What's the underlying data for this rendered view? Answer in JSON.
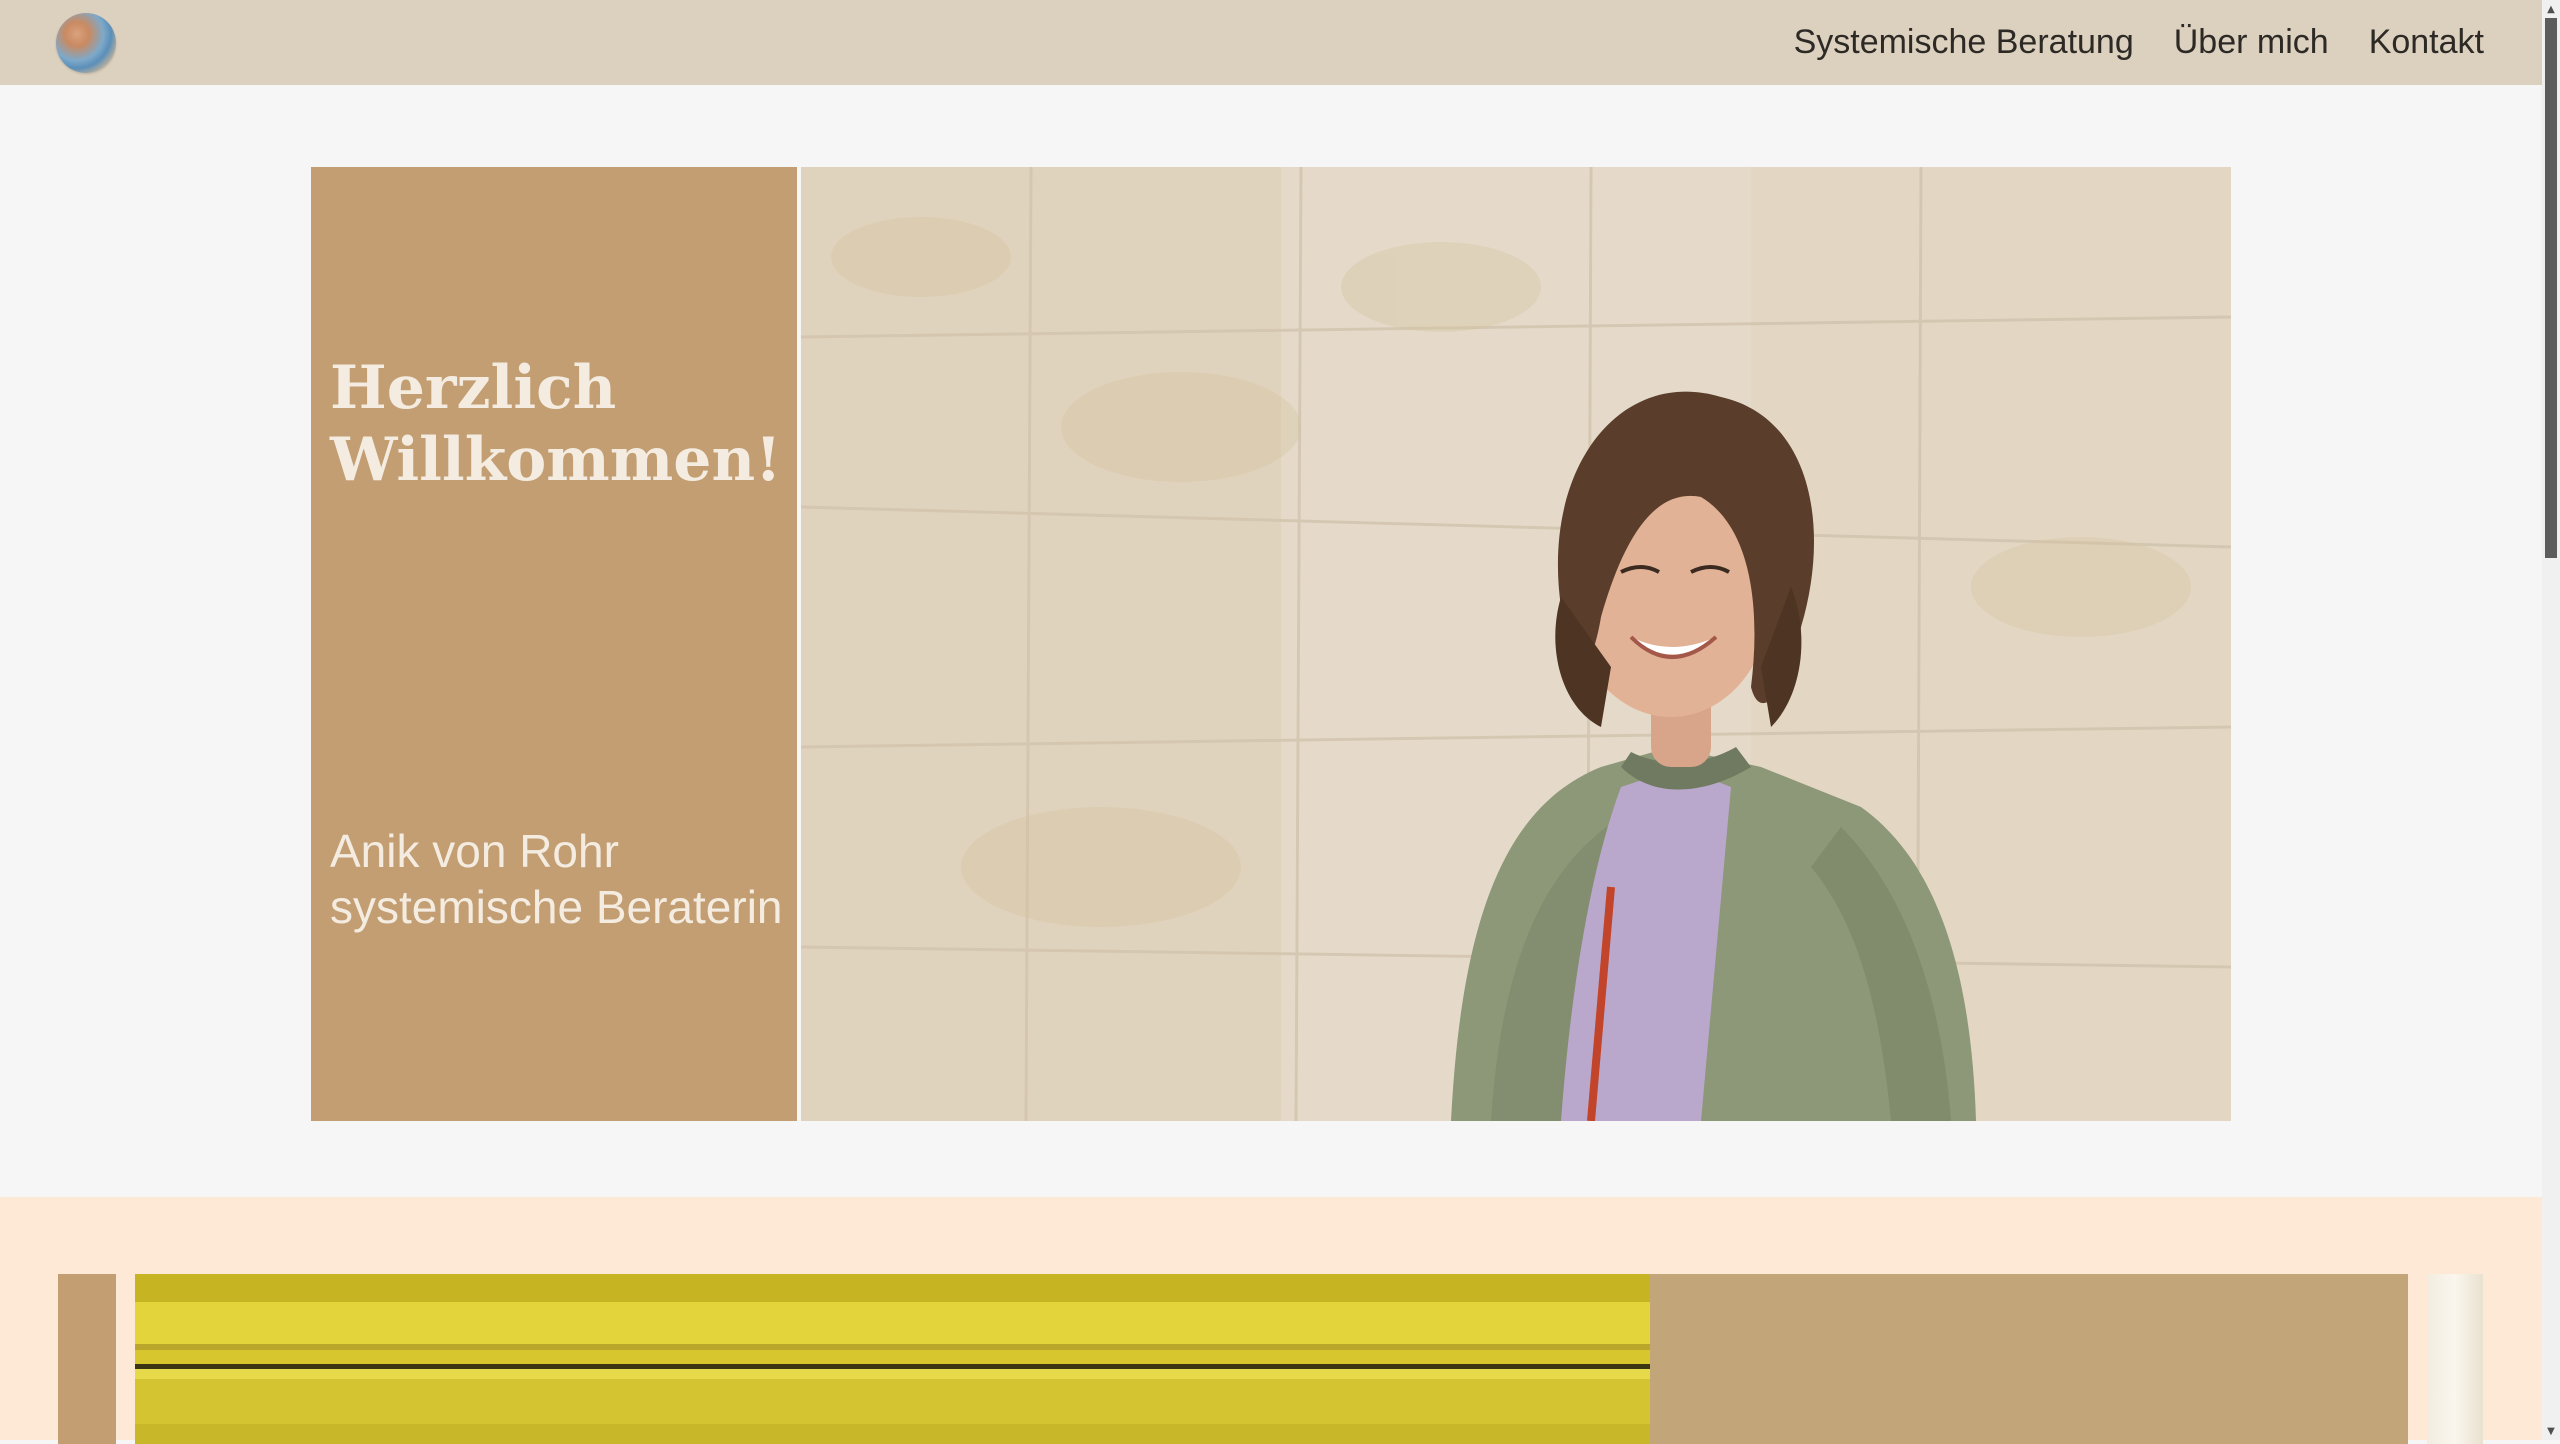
{
  "header": {
    "logo_icon": "globe-logo-icon",
    "nav": [
      {
        "label": "Systemische Beratung"
      },
      {
        "label": "Über mich"
      },
      {
        "label": "Kontakt"
      }
    ]
  },
  "hero": {
    "title": "Herzlich Willkommen!",
    "subtitle_name": "Anik von Rohr",
    "subtitle_role": "systemische Beraterin",
    "panel_color": "#c29e72",
    "photo_icon": "portrait-photo"
  },
  "section_two": {
    "background_color": "#fde9d5",
    "image_icon": "yellow-wood-photo",
    "tan_color": "#c3a57a"
  },
  "scrollbar": {
    "up_icon": "scroll-up-arrow-icon",
    "down_icon": "scroll-down-arrow-icon"
  }
}
